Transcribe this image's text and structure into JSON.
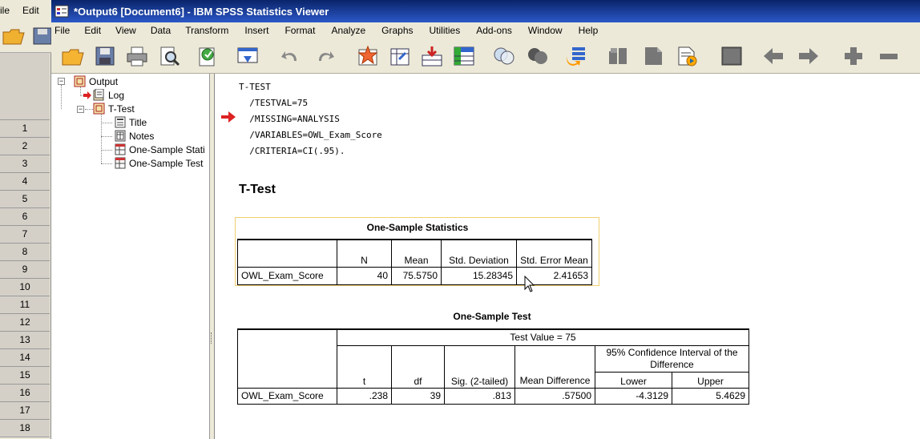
{
  "background_window": {
    "menu": [
      "ile",
      "Edit"
    ],
    "row_numbers": [
      "1",
      "2",
      "3",
      "4",
      "5",
      "6",
      "7",
      "8",
      "9",
      "10",
      "11",
      "12",
      "13",
      "14",
      "15",
      "16",
      "17",
      "18"
    ]
  },
  "window": {
    "title": "*Output6 [Document6] - IBM SPSS Statistics Viewer"
  },
  "menubar": [
    {
      "label": "File"
    },
    {
      "label": "Edit"
    },
    {
      "label": "View"
    },
    {
      "label": "Data"
    },
    {
      "label": "Transform"
    },
    {
      "label": "Insert"
    },
    {
      "label": "Format"
    },
    {
      "label": "Analyze"
    },
    {
      "label": "Graphs"
    },
    {
      "label": "Utilities"
    },
    {
      "label": "Add-ons"
    },
    {
      "label": "Window"
    },
    {
      "label": "Help"
    }
  ],
  "toolbar": {
    "icons": [
      "open-folder-icon",
      "save-icon",
      "print-icon",
      "print-preview-icon",
      "export-icon",
      "recall-dialog-icon",
      "undo-icon",
      "redo-icon",
      "goto-case-icon",
      "goto-variable-icon",
      "insert-cases-icon",
      "variables-icon",
      "select-cases-icon",
      "value-labels-icon",
      "use-sets-icon",
      "show-all-icon",
      "designate-window-icon",
      "insert-heading-icon",
      "insert-title-icon",
      "insert-text-icon",
      "hide-icon",
      "promote-icon",
      "demote-icon",
      "expand-icon",
      "collapse-icon"
    ]
  },
  "outline": {
    "nodes": [
      {
        "label": "Output"
      },
      {
        "label": "Log"
      },
      {
        "label": "T-Test"
      },
      {
        "label": "Title"
      },
      {
        "label": "Notes"
      },
      {
        "label": "One-Sample Stati"
      },
      {
        "label": "One-Sample Test"
      }
    ]
  },
  "syntax": {
    "lines": [
      "T-TEST",
      "  /TESTVAL=75",
      "  /MISSING=ANALYSIS",
      "  /VARIABLES=OWL_Exam_Score",
      "  /CRITERIA=CI(.95)."
    ]
  },
  "heading": "T-Test",
  "stats_table": {
    "title": "One-Sample Statistics",
    "headers": [
      "N",
      "Mean",
      "Std. Deviation",
      "Std. Error Mean"
    ],
    "row_label": "OWL_Exam_Score",
    "values": [
      "40",
      "75.5750",
      "15.28345",
      "2.41653"
    ]
  },
  "test_table": {
    "title": "One-Sample Test",
    "test_value": "Test Value = 75",
    "headers": [
      "t",
      "df",
      "Sig. (2-tailed)",
      "Mean Difference"
    ],
    "ci_header": "95% Confidence Interval of the Difference",
    "ci_sub": [
      "Lower",
      "Upper"
    ],
    "row_label": "OWL_Exam_Score",
    "values": [
      ".238",
      "39",
      ".813",
      ".57500",
      "-4.3129",
      "5.4629"
    ]
  }
}
